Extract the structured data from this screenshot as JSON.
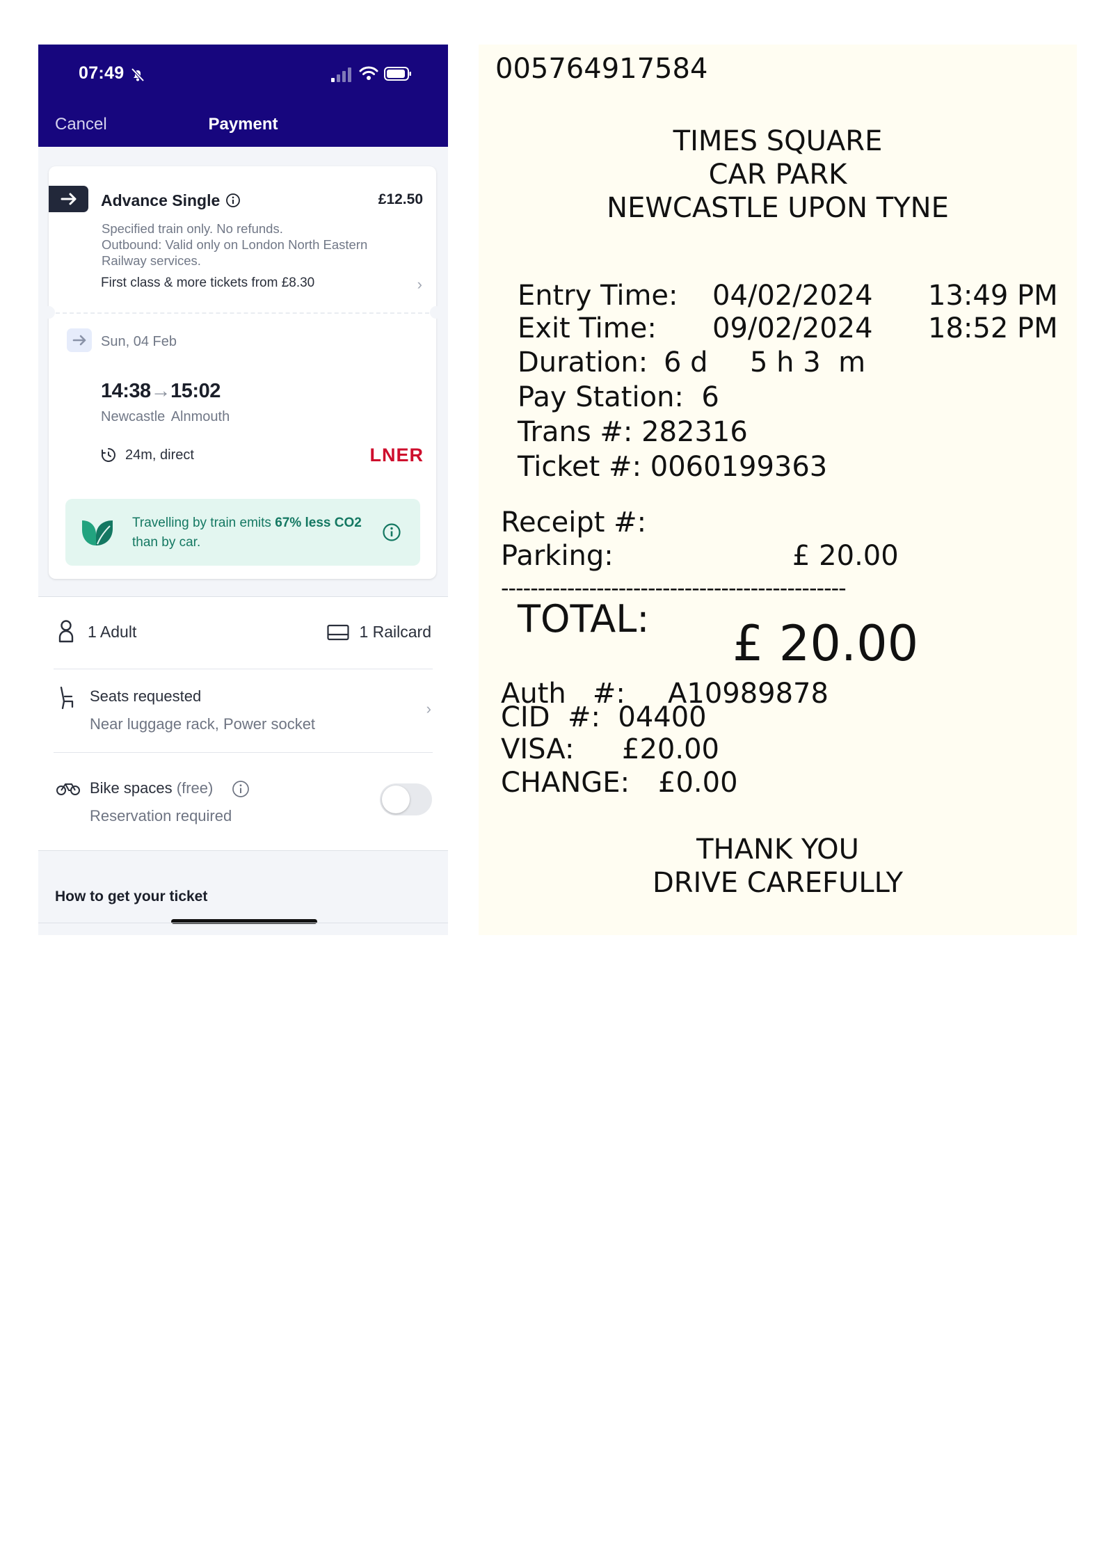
{
  "phone": {
    "status": {
      "time": "07:49"
    },
    "header": {
      "cancel_label": "Cancel",
      "title": "Payment"
    },
    "fare": {
      "name": "Advance Single",
      "price": "£12.50",
      "desc_line1": "Specified train only. No refunds.",
      "desc_line2": "Outbound: Valid only on London North Eastern Railway services.",
      "first_class": "First class & more tickets from £8.30"
    },
    "journey": {
      "date": "Sun, 04 Feb",
      "depart": "14:38",
      "arrive": "15:02",
      "origin": "Newcastle",
      "destination": "Alnmouth",
      "duration": "24m, direct",
      "operator": "LNER"
    },
    "eco": {
      "text_start": "Travelling by train emits ",
      "percent": "67%",
      "bold_tail": "less CO2",
      "text_end": " than by car."
    },
    "passengers": {
      "adults": "1 Adult",
      "railcard": "1 Railcard"
    },
    "seats": {
      "label": "Seats requested",
      "detail": "Near luggage rack, Power socket"
    },
    "bike": {
      "label": "Bike spaces",
      "free": "(free)",
      "detail": "Reservation required",
      "enabled": false
    },
    "how_to": "How to get your ticket",
    "colors": {
      "header": "#17067e",
      "eco_bg": "#e3f6f0",
      "eco_text": "#147862",
      "lner_red": "#ce0e2d"
    }
  },
  "receipt": {
    "number": "005764917584",
    "title_line1": "TIMES SQUARE",
    "title_line2": "CAR PARK",
    "title_line3": "NEWCASTLE UPON TYNE",
    "entry_label": "Entry Time:",
    "entry_date": "04/02/2024",
    "entry_time": "13:49 PM",
    "exit_label": "Exit Time:",
    "exit_date": "09/02/2024",
    "exit_time": "18:52 PM",
    "duration_label": "Duration:",
    "duration_days": "6 d",
    "duration_hm": "5 h 3  m",
    "pay_station": "Pay Station:  6",
    "trans": "Trans #: 282316",
    "ticket": "Ticket #: 0060199363",
    "receipt_label": "Receipt #:",
    "parking_label": "Parking:",
    "parking_amount": "£ 20.00",
    "separator": "-----------------------------------------------",
    "total_label": "TOTAL:",
    "total_amount": "£ 20.00",
    "auth_label": "Auth   #:",
    "auth_value": "A10989878",
    "cid": "CID  #:  04400",
    "visa_label": "VISA:",
    "visa_amount": "£20.00",
    "change_label": "CHANGE:",
    "change_amount": "£0.00",
    "thanks_line1": "THANK YOU",
    "thanks_line2": "DRIVE CAREFULLY"
  }
}
